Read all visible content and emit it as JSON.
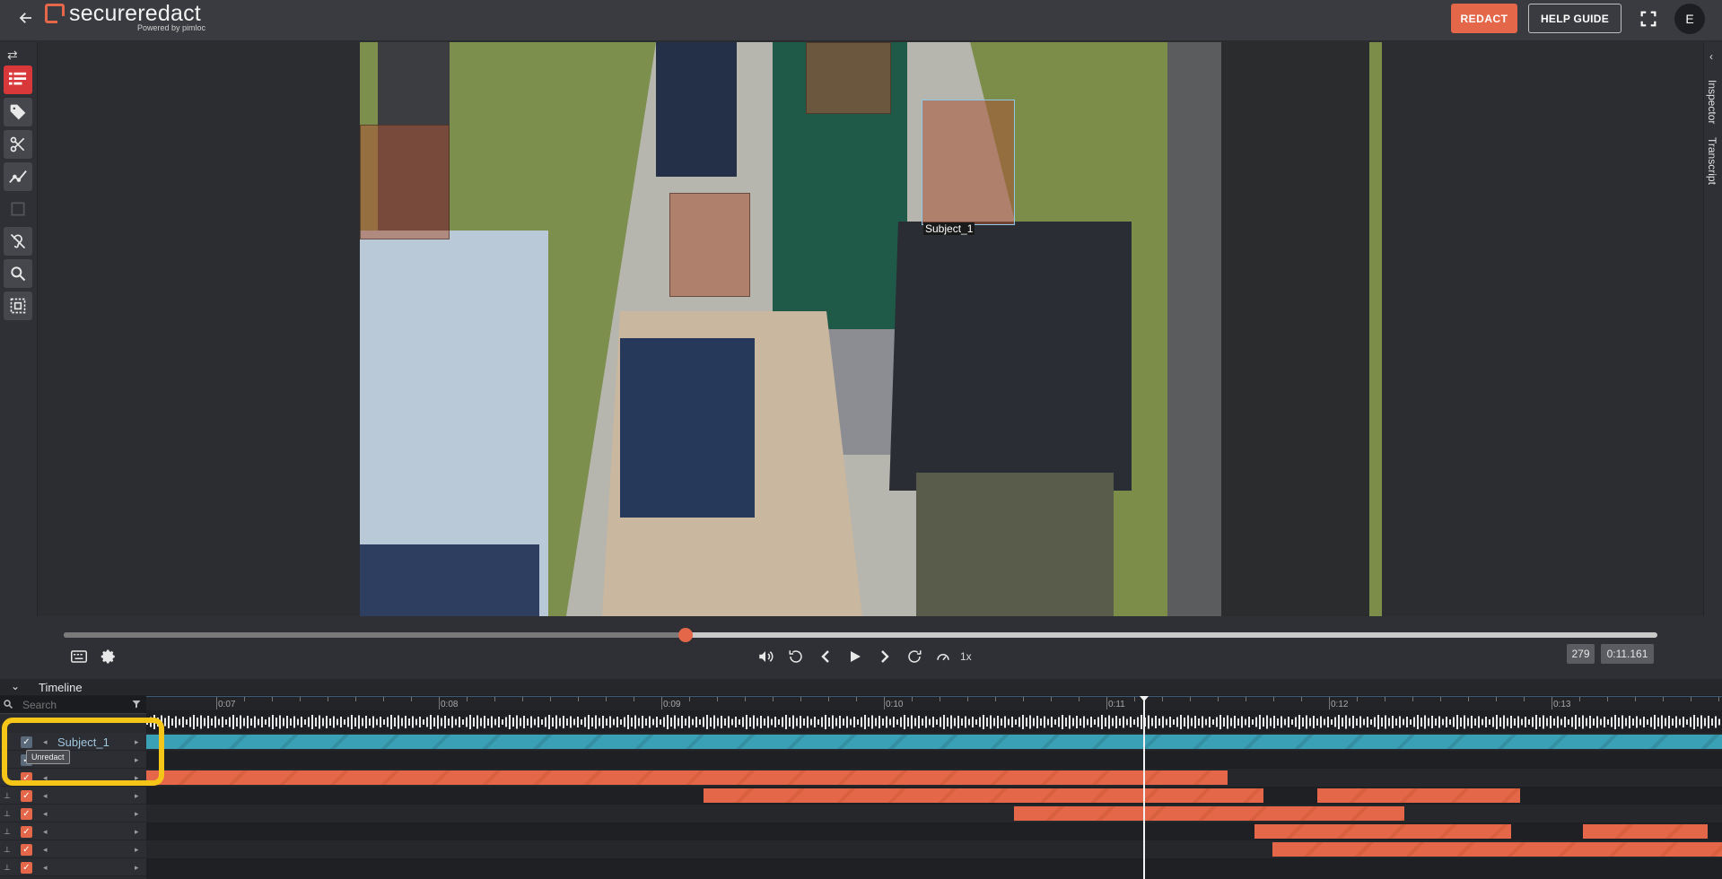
{
  "header": {
    "back_icon": "arrow-left-icon",
    "logo_text": "secure",
    "logo_text_bold": "redact",
    "logo_sub": "Powered by pimloc",
    "redact_label": "REDACT",
    "help_label": "HELP GUIDE",
    "avatar_initial": "E",
    "accent_color": "#e4674a"
  },
  "toolbar": {
    "tools": [
      {
        "name": "redaction-list-icon",
        "active": true
      },
      {
        "name": "tag-icon"
      },
      {
        "name": "scissors-icon"
      },
      {
        "name": "tracking-icon"
      },
      {
        "name": "box-select-icon",
        "disabled": true
      },
      {
        "name": "audio-redact-icon"
      },
      {
        "name": "search-icon"
      },
      {
        "name": "frame-select-icon"
      }
    ]
  },
  "right_panel": {
    "tabs": [
      "Inspector",
      "Transcript"
    ]
  },
  "video": {
    "subject_label": "Subject_1"
  },
  "controls": {
    "progress": 0.39,
    "speed": "1x",
    "frame": "279",
    "time": "0:11.161"
  },
  "timeline": {
    "title": "Timeline",
    "search_placeholder": "Search",
    "ticks": [
      "0:07",
      "0:08",
      "0:09",
      "0:10",
      "0:11",
      "0:12",
      "0:13"
    ],
    "track_label": "Subject_1",
    "tooltip": "Unredact"
  }
}
